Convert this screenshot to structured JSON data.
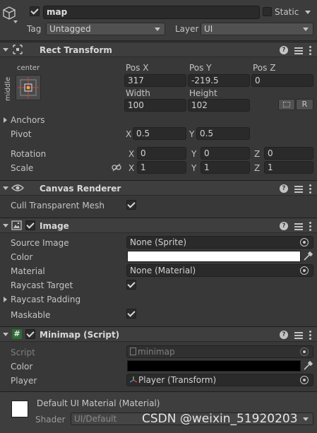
{
  "gameobject": {
    "name": "map",
    "active": true,
    "static_label": "Static",
    "tag_label": "Tag",
    "tag_value": "Untagged",
    "layer_label": "Layer",
    "layer_value": "UI"
  },
  "rect_transform": {
    "title": "Rect Transform",
    "anchor_h": "center",
    "anchor_v": "middle",
    "pos_x_label": "Pos X",
    "pos_y_label": "Pos Y",
    "pos_z_label": "Pos Z",
    "pos_x": "317",
    "pos_y": "-219.5",
    "pos_z": "0",
    "width_label": "Width",
    "height_label": "Height",
    "width": "100",
    "height": "102",
    "raw_button": "R",
    "anchors_label": "Anchors",
    "pivot_label": "Pivot",
    "pivot_x": "0.5",
    "pivot_y": "0.5",
    "rotation_label": "Rotation",
    "rot_x": "0",
    "rot_y": "0",
    "rot_z": "0",
    "scale_label": "Scale",
    "scale_x": "1",
    "scale_y": "1",
    "scale_z": "1",
    "axis_x": "X",
    "axis_y": "Y",
    "axis_z": "Z"
  },
  "canvas_renderer": {
    "title": "Canvas Renderer",
    "cull_label": "Cull Transparent Mesh",
    "cull_value": true
  },
  "image": {
    "title": "Image",
    "enabled": true,
    "source_image_label": "Source Image",
    "source_image_value": "None (Sprite)",
    "color_label": "Color",
    "color_value": "#ffffff",
    "material_label": "Material",
    "material_value": "None (Material)",
    "raycast_target_label": "Raycast Target",
    "raycast_target_value": true,
    "raycast_padding_label": "Raycast Padding",
    "maskable_label": "Maskable",
    "maskable_value": true
  },
  "minimap": {
    "title": "Minimap (Script)",
    "enabled": true,
    "script_label": "Script",
    "script_value": "minimap",
    "color_label": "Color",
    "color_value": "#000000",
    "player_label": "Player",
    "player_value": "Player  (Transform)"
  },
  "material": {
    "title": "Default UI Material (Material)",
    "shader_label": "Shader",
    "shader_value": "UI/Default",
    "watermark": "CSDN @weixin_51920203"
  },
  "icons": {
    "gameobject": "cube-icon",
    "rect_transform": "rect-transform-icon",
    "canvas_renderer": "eye-icon",
    "image": "image-icon",
    "minimap": "script-icon",
    "help": "help-icon",
    "presets": "presets-icon",
    "menu": "kebab-menu-icon",
    "object_picker": "object-picker-icon",
    "eyedropper": "eyedropper-icon",
    "link": "link-icon"
  }
}
